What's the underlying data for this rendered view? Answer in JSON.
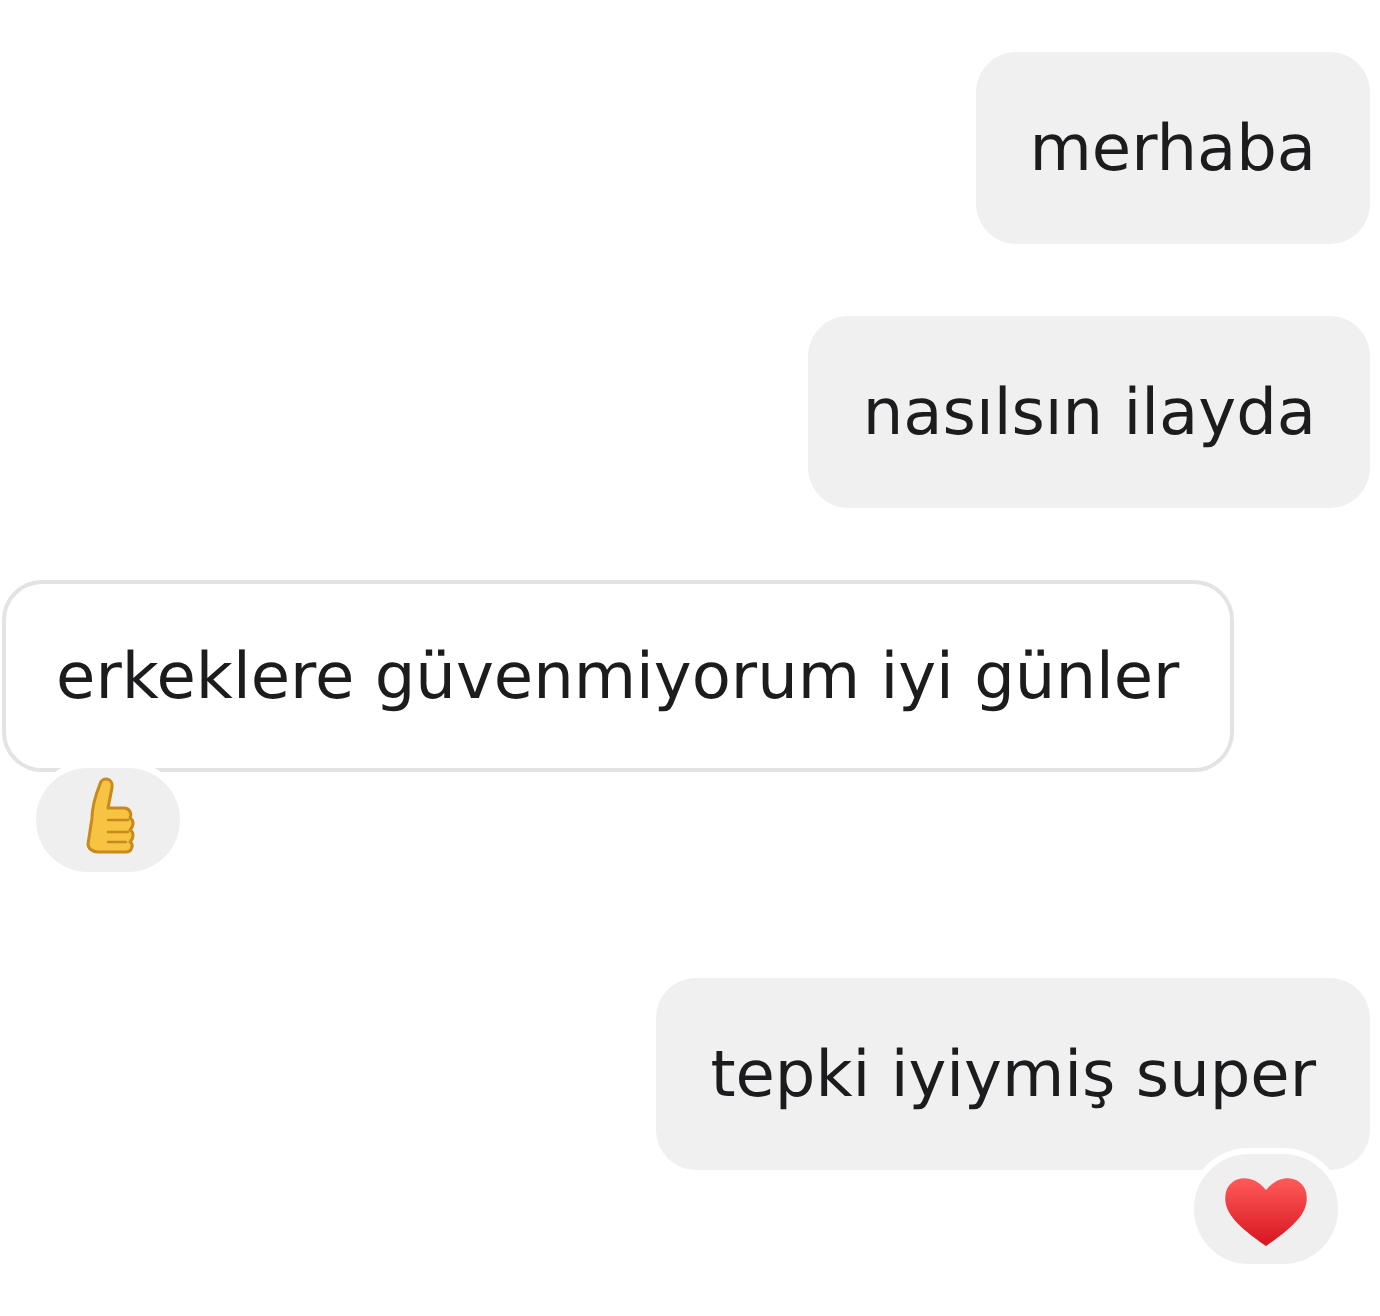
{
  "messages": [
    {
      "kind": "sent",
      "text": "merhaba"
    },
    {
      "kind": "sent",
      "text": "nasılsın ilayda"
    },
    {
      "kind": "received",
      "text": "erkeklere güvenmiyorum iyi günler",
      "reaction": {
        "kind": "thumbs_up"
      }
    },
    {
      "kind": "sent",
      "text": "tepki iyiymiş super",
      "reaction": {
        "kind": "heart"
      }
    }
  ]
}
